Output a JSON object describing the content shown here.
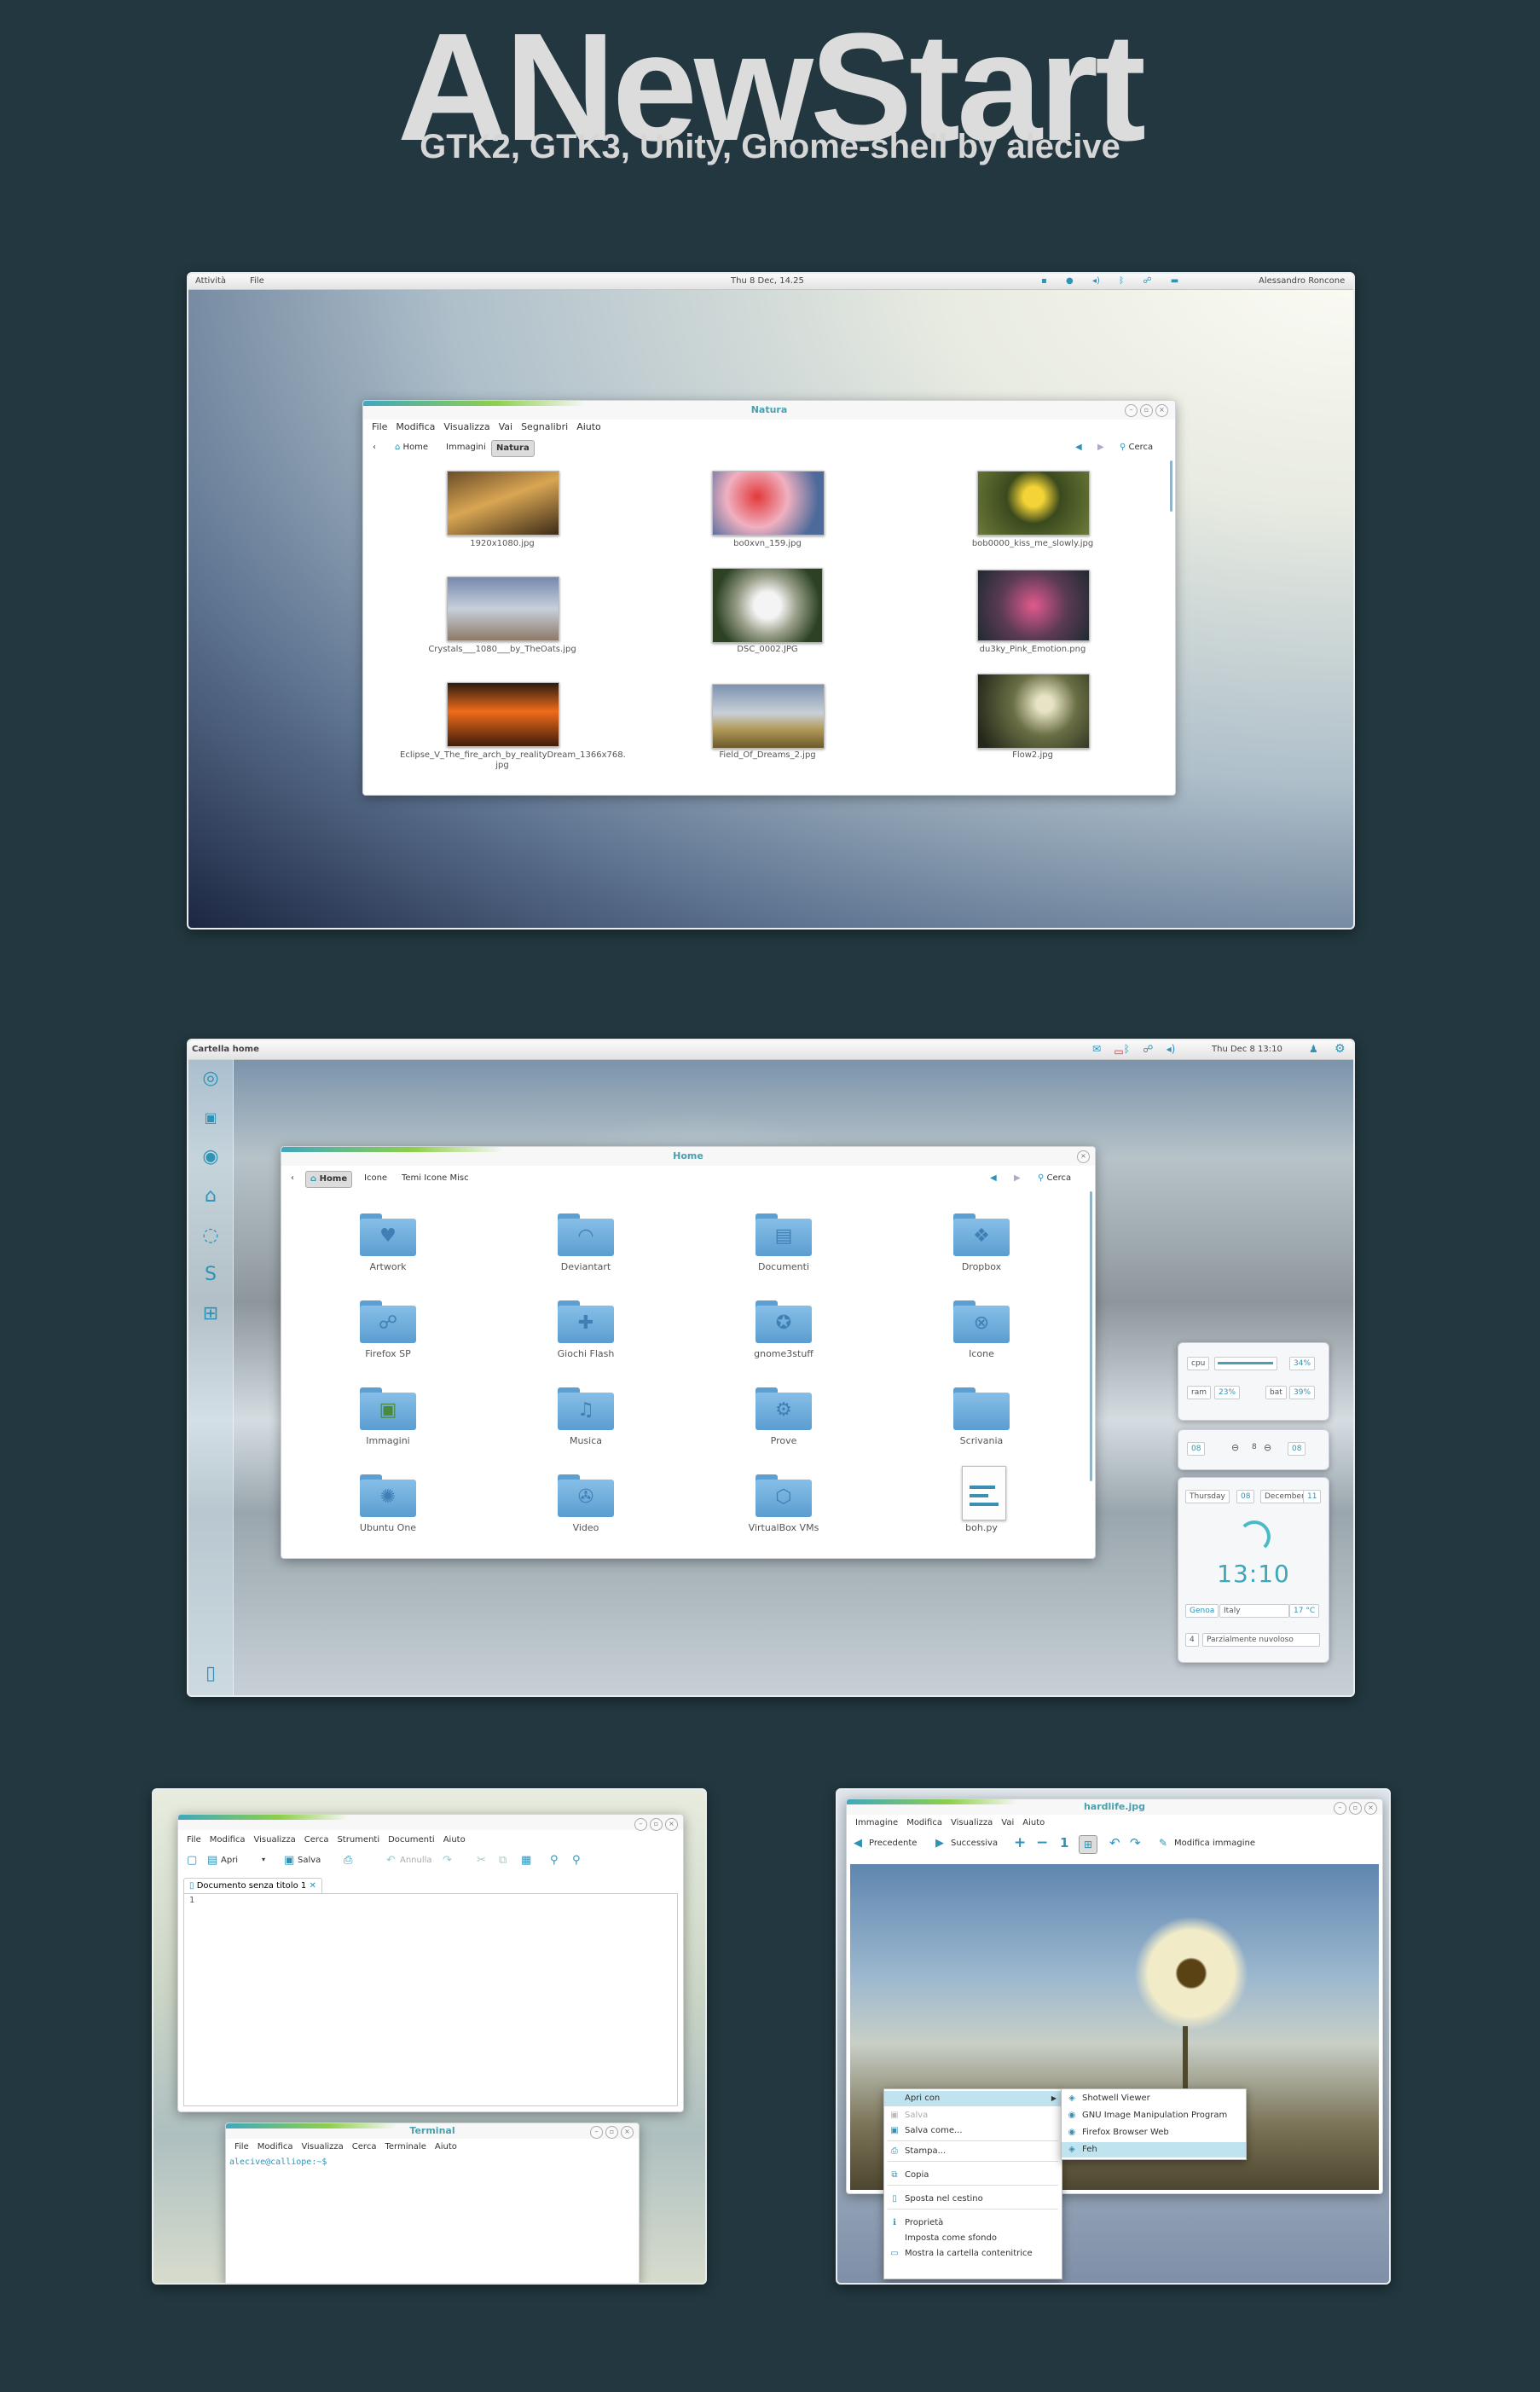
{
  "header": {
    "title": "ANewStart",
    "subtitle": "GTK2, GTK3, Unity, Gnome-shell by alecive"
  },
  "colors": {
    "background": "#22373f",
    "accent": "#2e93b7",
    "accent_green": "#8ed04a"
  },
  "screen1": {
    "topbar": {
      "activities": "Attività",
      "file": "File",
      "clock": "Thu  8 Dec, 14.25",
      "user": "Alessandro Roncone"
    },
    "window": {
      "title": "Natura",
      "menu": [
        "File",
        "Modifica",
        "Visualizza",
        "Vai",
        "Segnalibri",
        "Aiuto"
      ],
      "breadcrumbs": [
        "Home",
        "Immagini",
        "Natura"
      ],
      "search_label": "Cerca",
      "files": [
        "1920x1080.jpg",
        "bo0xvn_159.jpg",
        "bob0000_kiss_me_slowly.jpg",
        "Crystals___1080___by_TheOats.jpg",
        "DSC_0002.JPG",
        "du3ky_Pink_Emotion.png",
        "Eclipse_V_The_fire_arch_by_realityDream_1366x768.\njpg",
        "Field_Of_Dreams_2.jpg",
        "Flow2.jpg"
      ]
    }
  },
  "screen2": {
    "panel": {
      "app": "Cartella home",
      "clock": "Thu Dec  8 13:10"
    },
    "launcher_icons": [
      "ubuntu-logo-icon",
      "terminal-icon",
      "firefox-icon",
      "home-icon",
      "chromium-icon",
      "skype-icon",
      "workspace-switcher-icon",
      "trash-icon"
    ],
    "window": {
      "title": "Home",
      "breadcrumbs": [
        "Home",
        "Icone",
        "Temi Icone Misc"
      ],
      "search_label": "Cerca",
      "folders": [
        "Artwork",
        "Deviantart",
        "Documenti",
        "Dropbox",
        "Firefox SP",
        "Giochi Flash",
        "gnome3stuff",
        "Icone",
        "Immagini",
        "Musica",
        "Prove",
        "Scrivania",
        "Ubuntu One",
        "Video",
        "VirtualBox VMs",
        "boh.py"
      ]
    },
    "widgets": {
      "cpu_label": "cpu",
      "cpu_value": "34%",
      "ram_label": "ram",
      "ram_value": "23%",
      "bat_label": "bat",
      "bat_value": "39%",
      "vol_left": "08",
      "vol_mid": "8",
      "vol_right": "08",
      "day": "Thursday",
      "date_num": "08",
      "month": "December",
      "year_short": "11",
      "time": "13:10",
      "city": "Genoa",
      "country": "Italy",
      "temp": "17 °C",
      "forecast": "Parzialmente nuvoloso",
      "forecast_num": "4"
    }
  },
  "screen3": {
    "editor": {
      "menu": [
        "File",
        "Modifica",
        "Visualizza",
        "Cerca",
        "Strumenti",
        "Documenti",
        "Aiuto"
      ],
      "toolbar": {
        "open": "Apri",
        "save": "Salva",
        "undo": "Annulla"
      },
      "tab": "Documento senza titolo 1",
      "line_number": "1"
    },
    "terminal": {
      "title": "Terminal",
      "menu": [
        "File",
        "Modifica",
        "Visualizza",
        "Cerca",
        "Terminale",
        "Aiuto"
      ],
      "prompt": "alecive@calliope:~$"
    }
  },
  "screen4": {
    "viewer": {
      "title": "hardlife.jpg",
      "menu": [
        "Immagine",
        "Modifica",
        "Visualizza",
        "Vai",
        "Aiuto"
      ],
      "toolbar": {
        "prev": "Precedente",
        "next": "Successiva",
        "zoom_one": "1",
        "edit": "Modifica immagine"
      }
    },
    "context_menu": [
      "Apri con",
      "Salva",
      "Salva come...",
      "Stampa...",
      "Copia",
      "Sposta nel cestino",
      "Proprietà",
      "Imposta come sfondo",
      "Mostra la cartella contenitrice"
    ],
    "open_with": [
      "Shotwell Viewer",
      "GNU Image Manipulation Program",
      "Firefox Browser Web",
      "Feh"
    ]
  }
}
